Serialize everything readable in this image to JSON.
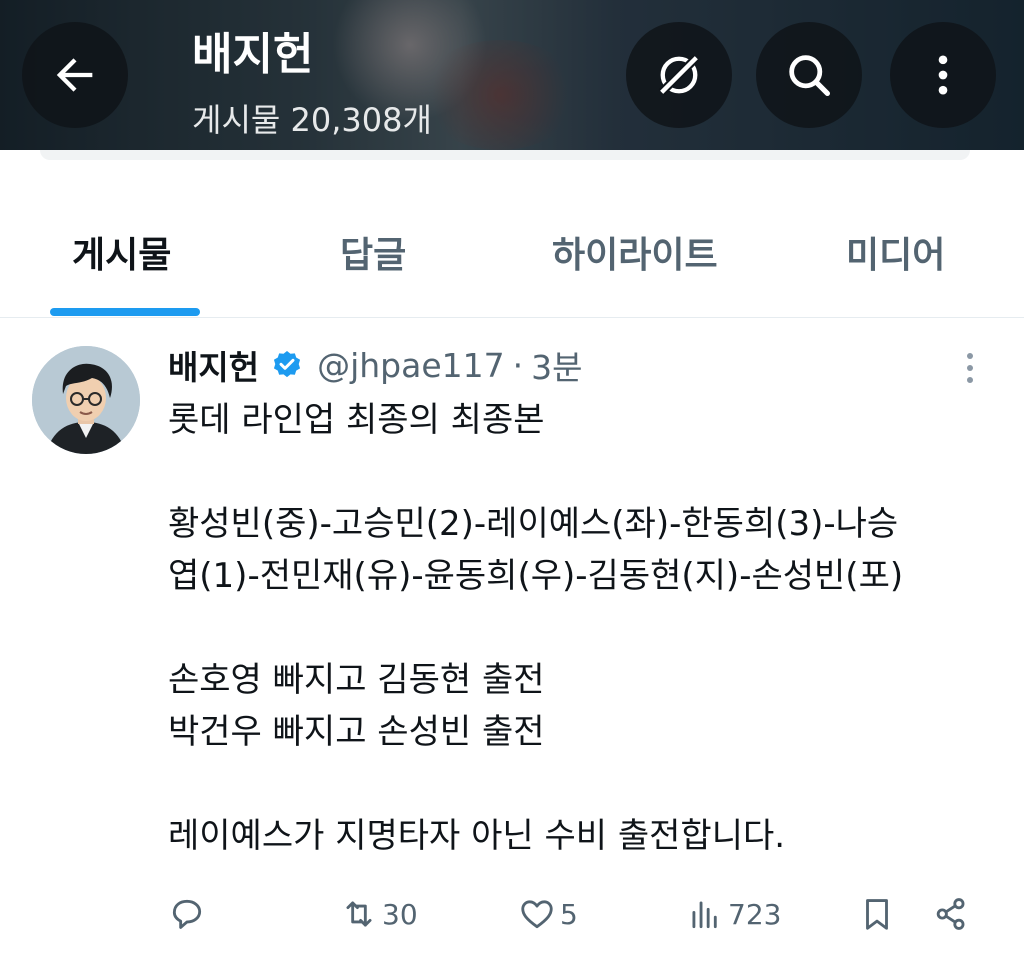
{
  "header": {
    "title": "배지헌",
    "subtitle": "게시물 20,308개"
  },
  "tabs": [
    {
      "label": "게시물",
      "active": true
    },
    {
      "label": "답글",
      "active": false
    },
    {
      "label": "하이라이트",
      "active": false
    },
    {
      "label": "미디어",
      "active": false
    }
  ],
  "post": {
    "author": "배지헌",
    "handle": "@jhpae117",
    "separator": "·",
    "time": "3분",
    "lines": [
      "롯데 라인업 최종의 최종본",
      "",
      "황성빈(중)-고승민(2)-레이예스(좌)-한동희(3)-나승",
      "엽(1)-전민재(유)-윤동희(우)-김동현(지)-손성빈(포)",
      "",
      "손호영 빠지고 김동현 출전",
      "박건우 빠지고 손성빈 출전",
      "",
      "레이예스가 지명타자 아닌 수비 출전합니다."
    ],
    "stats": {
      "replies": "",
      "reposts": "30",
      "likes": "5",
      "views": "723"
    }
  },
  "colors": {
    "accent": "#1d9bf0",
    "text_primary": "#0f1419",
    "text_secondary": "#536471"
  }
}
